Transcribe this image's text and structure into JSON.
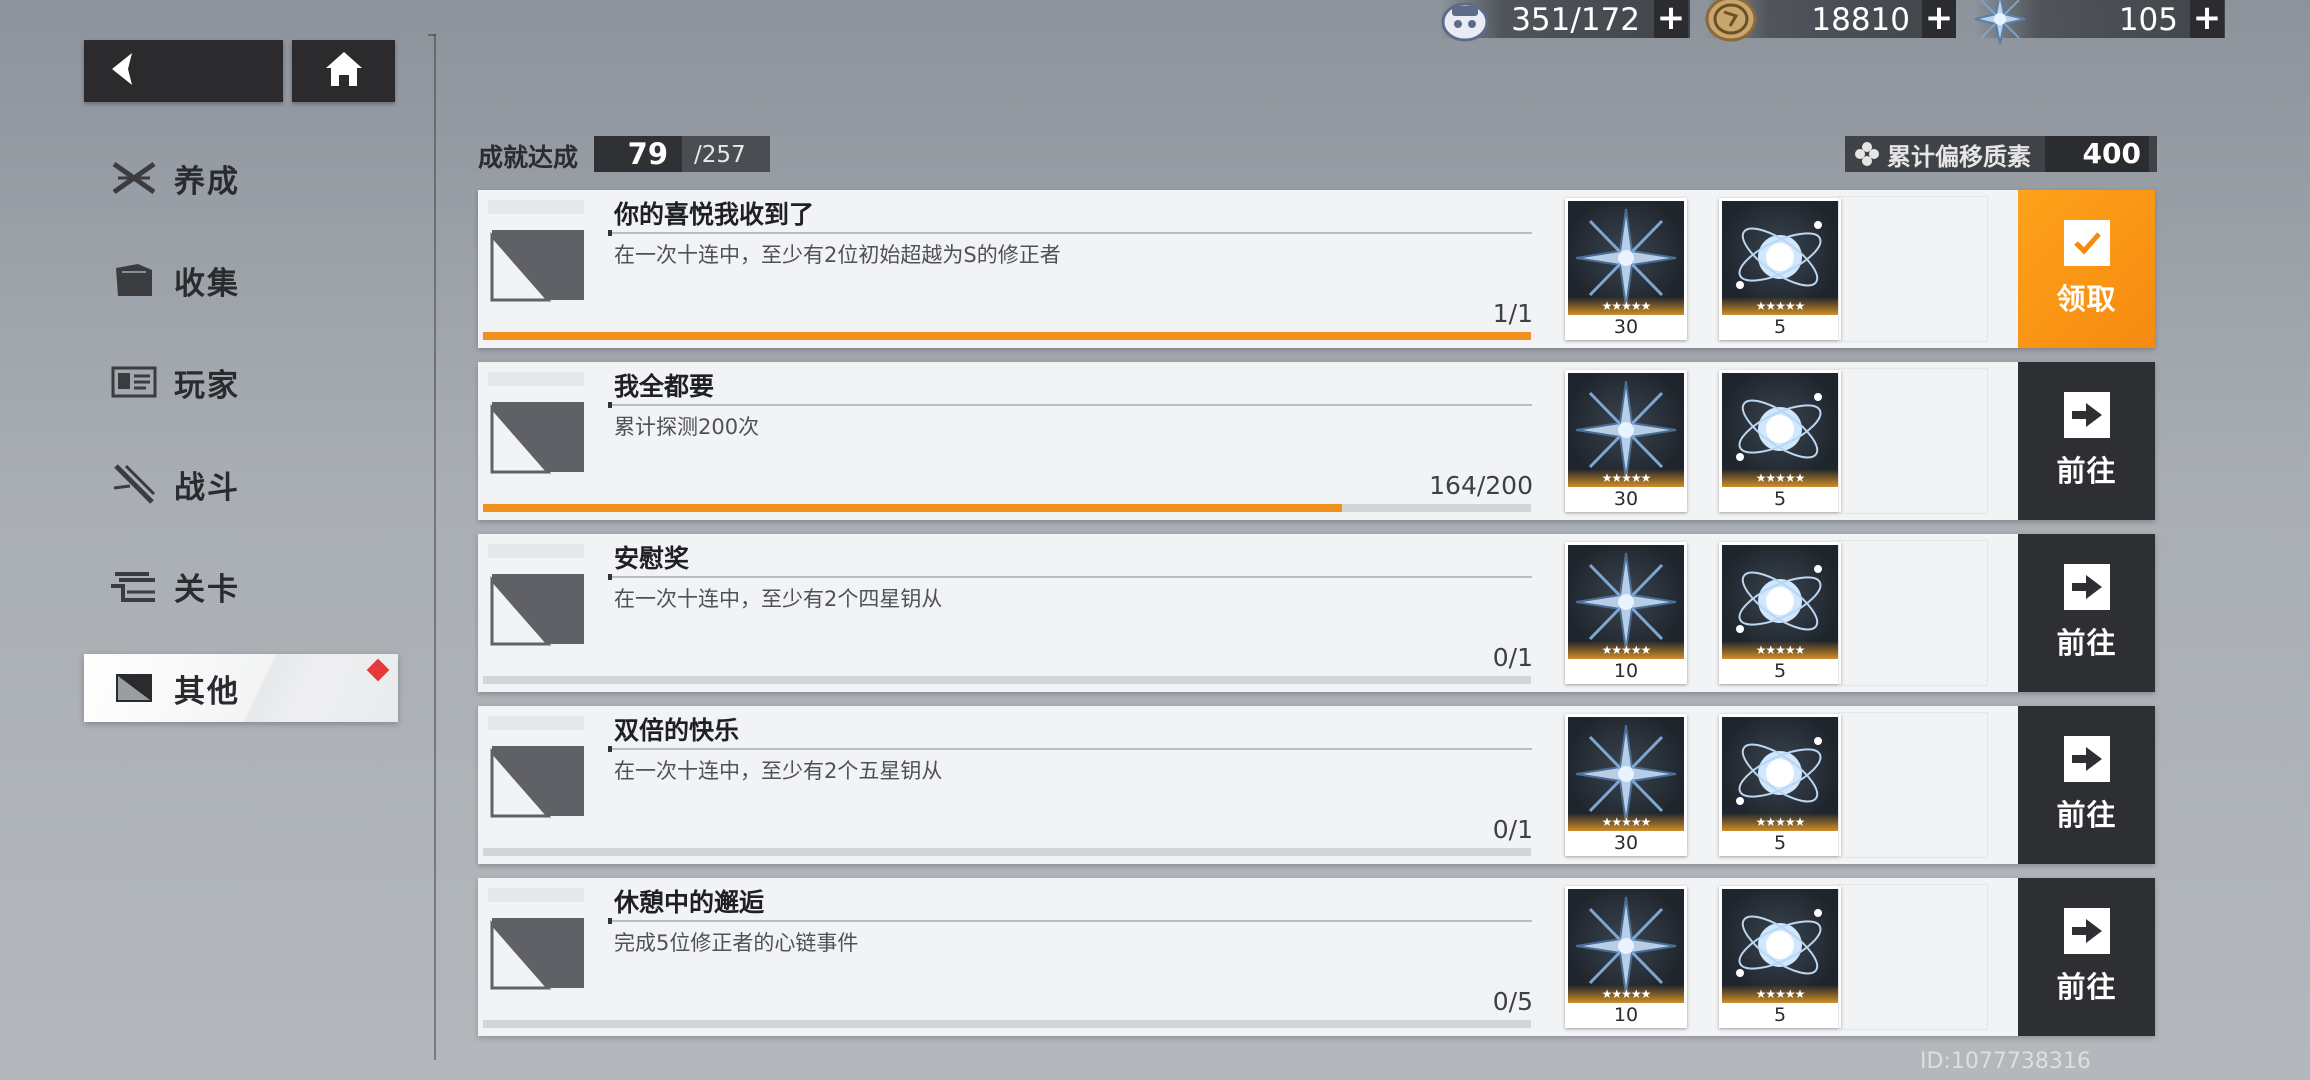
{
  "nav": {
    "back_icon": "back-arrow-icon",
    "home_icon": "home-icon",
    "items": [
      {
        "label": "养成",
        "icon": "cross-blades-icon"
      },
      {
        "label": "收集",
        "icon": "folder-icon"
      },
      {
        "label": "玩家",
        "icon": "id-card-icon"
      },
      {
        "label": "战斗",
        "icon": "sword-icon"
      },
      {
        "label": "关卡",
        "icon": "stairs-icon"
      },
      {
        "label": "其他",
        "icon": "other-icon"
      }
    ],
    "active_index": 5
  },
  "currencies": [
    {
      "icon": "stamina-icon",
      "value": "351/172"
    },
    {
      "icon": "coin-icon",
      "value": "18810"
    },
    {
      "icon": "crystal-icon",
      "value": "105"
    }
  ],
  "achievement": {
    "label": "成就达成",
    "current": "79",
    "total": "/257"
  },
  "cumulative": {
    "label": "累计偏移质素",
    "value": "400"
  },
  "cards": [
    {
      "title": "你的喜悦我收到了",
      "desc": "在一次十连中，至少有2位初始超越为S的修正者",
      "progress": "1/1",
      "progress_fraction": 1.0,
      "rewards": [
        {
          "icon": "crystal-shard-reward-icon",
          "count": "30"
        },
        {
          "icon": "energy-orb-reward-icon",
          "count": "5"
        }
      ],
      "action": "领取",
      "action_type": "claim"
    },
    {
      "title": "我全都要",
      "desc": "累计探测200次",
      "progress": "164/200",
      "progress_fraction": 0.82,
      "rewards": [
        {
          "icon": "crystal-shard-reward-icon",
          "count": "30"
        },
        {
          "icon": "energy-orb-reward-icon",
          "count": "5"
        }
      ],
      "action": "前往",
      "action_type": "go"
    },
    {
      "title": "安慰奖",
      "desc": "在一次十连中，至少有2个四星钥从",
      "progress": "0/1",
      "progress_fraction": 0,
      "rewards": [
        {
          "icon": "crystal-shard-reward-icon",
          "count": "10"
        },
        {
          "icon": "energy-orb-reward-icon",
          "count": "5"
        }
      ],
      "action": "前往",
      "action_type": "go"
    },
    {
      "title": "双倍的快乐",
      "desc": "在一次十连中，至少有2个五星钥从",
      "progress": "0/1",
      "progress_fraction": 0,
      "rewards": [
        {
          "icon": "crystal-shard-reward-icon",
          "count": "30"
        },
        {
          "icon": "energy-orb-reward-icon",
          "count": "5"
        }
      ],
      "action": "前往",
      "action_type": "go"
    },
    {
      "title": "休憩中的邂逅",
      "desc": "完成5位修正者的心链事件",
      "progress": "0/5",
      "progress_fraction": 0,
      "rewards": [
        {
          "icon": "crystal-shard-reward-icon",
          "count": "10"
        },
        {
          "icon": "energy-orb-reward-icon",
          "count": "5"
        }
      ],
      "action": "前往",
      "action_type": "go"
    }
  ],
  "reward_stars": "★★★★★",
  "player_id": "ID:1077738316",
  "colors": {
    "accent": "#f1901f",
    "dark": "#2e2f32"
  }
}
